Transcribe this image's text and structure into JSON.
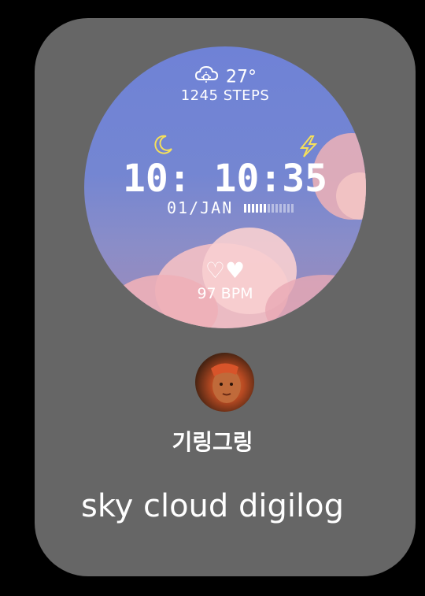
{
  "watchface": {
    "weather_icon": "cloud-sun-icon",
    "temperature": "27°",
    "steps": "1245 STEPS",
    "time": "10: 10:35",
    "date": "01/JAN",
    "heart_icons": "♡♥",
    "bpm": "97 BPM",
    "battery_level_fraction": 0.45,
    "colors": {
      "accent": "#f5e05a",
      "sky": "#6f82d6",
      "cloud": "#f2b3b8"
    }
  },
  "author": {
    "name": "기링그링"
  },
  "watchface_title": "sky cloud digilog"
}
